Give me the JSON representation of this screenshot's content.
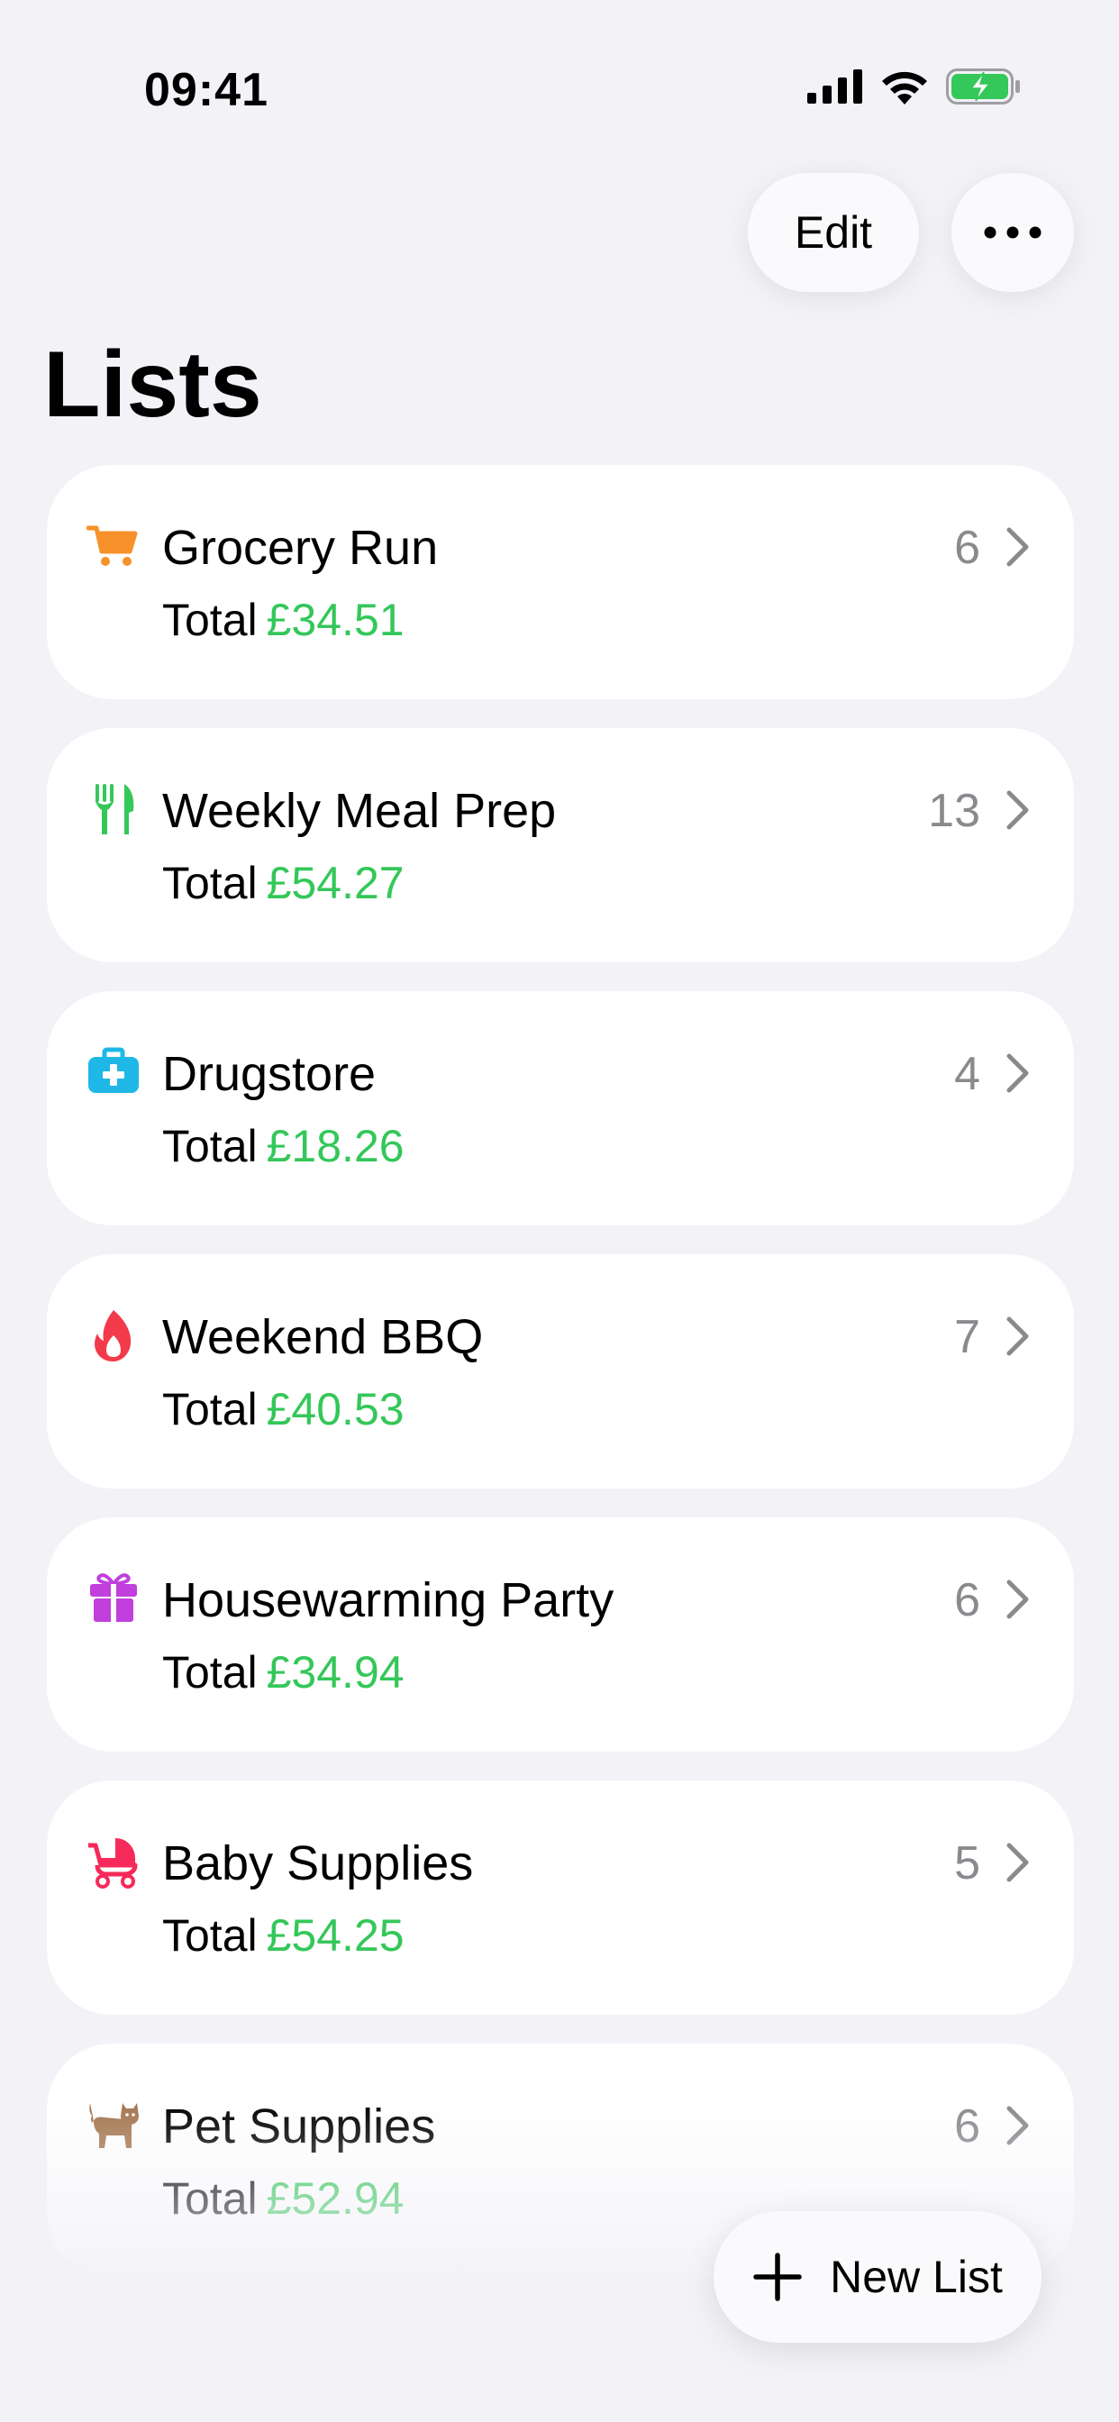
{
  "status_bar": {
    "time": "09:41"
  },
  "toolbar": {
    "edit_label": "Edit",
    "more_icon": "ellipsis-icon"
  },
  "page": {
    "title": "Lists"
  },
  "lists": [
    {
      "name": "Grocery Run",
      "count": "6",
      "total_label": "Total",
      "total": "£34.51",
      "icon": "cart-icon",
      "icon_color": "#f7912a"
    },
    {
      "name": "Weekly Meal Prep",
      "count": "13",
      "total_label": "Total",
      "total": "£54.27",
      "icon": "fork-knife-icon",
      "icon_color": "#34c759"
    },
    {
      "name": "Drugstore",
      "count": "4",
      "total_label": "Total",
      "total": "£18.26",
      "icon": "medical-kit-icon",
      "icon_color": "#1fb8e6"
    },
    {
      "name": "Weekend BBQ",
      "count": "7",
      "total_label": "Total",
      "total": "£40.53",
      "icon": "flame-icon",
      "icon_color": "#f23a4b"
    },
    {
      "name": "Housewarming Party",
      "count": "6",
      "total_label": "Total",
      "total": "£34.94",
      "icon": "gift-icon",
      "icon_color": "#c13fdc"
    },
    {
      "name": "Baby Supplies",
      "count": "5",
      "total_label": "Total",
      "total": "£54.25",
      "icon": "stroller-icon",
      "icon_color": "#f52a5a"
    },
    {
      "name": "Pet Supplies",
      "count": "6",
      "total_label": "Total",
      "total": "£52.94",
      "icon": "cat-icon",
      "icon_color": "#a4764f"
    }
  ],
  "new_list": {
    "label": "New List",
    "icon": "plus-icon"
  },
  "colors": {
    "background": "#f2f2f7",
    "total_value": "#34c759",
    "count": "#8a8a8e"
  }
}
